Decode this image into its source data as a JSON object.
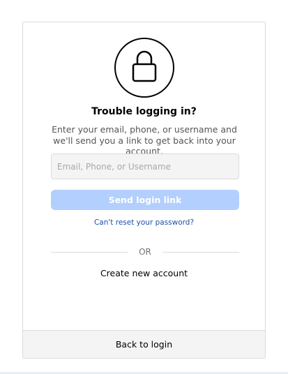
{
  "card": {
    "title": "Trouble logging in?",
    "description": "Enter your email, phone, or username and we'll send you a link to get back into your account.",
    "input_placeholder": "Email, Phone, or Username",
    "input_value": "",
    "send_button_label": "Send login link",
    "reset_link_label": "Can't reset your password?",
    "divider_label": "OR",
    "create_account_label": "Create new account",
    "back_to_login_label": "Back to login"
  },
  "icons": {
    "lock": "lock-icon"
  },
  "colors": {
    "send_button_disabled": "#b2cffd",
    "link_blue": "#1a4fa8",
    "border": "#dbdbdb",
    "input_bg": "#f4f4f5"
  }
}
